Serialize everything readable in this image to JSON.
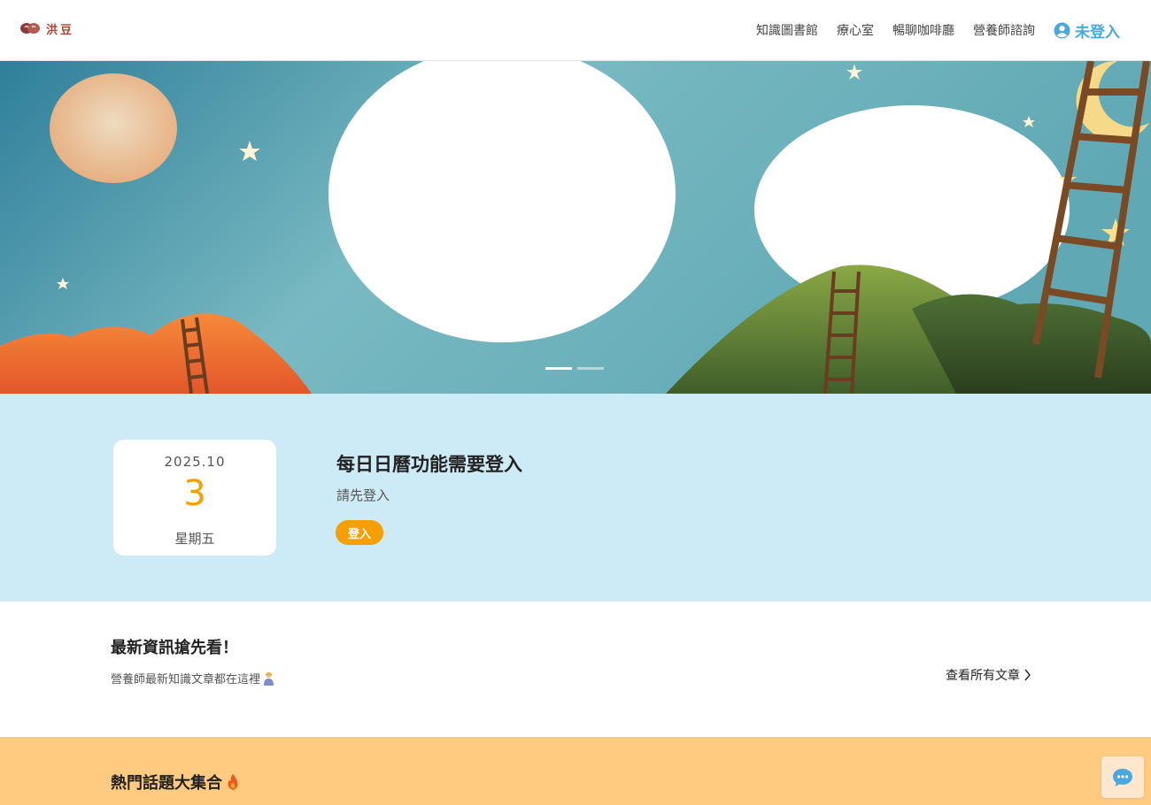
{
  "header": {
    "brand": "洪豆",
    "nav": [
      {
        "label": "知識圖書館"
      },
      {
        "label": "療心室"
      },
      {
        "label": "暢聊咖啡廳"
      },
      {
        "label": "營養師諮詢"
      }
    ],
    "user_label": "未登入",
    "user_icon": "user-circle-icon"
  },
  "banner": {
    "slides_total": 2,
    "active_slide": 1
  },
  "calendar": {
    "year_month": "2025.10",
    "day": "3",
    "weekday": "星期五",
    "title": "每日日曆功能需要登入",
    "subtitle": "請先登入",
    "login_button": "登入"
  },
  "news": {
    "title": "最新資訊搶先看！",
    "subtitle": "營養師最新知識文章都在這裡",
    "all_link": "查看所有文章"
  },
  "hot": {
    "title": "熱門話題大集合"
  },
  "colors": {
    "accent_blue": "#49a8dc",
    "accent_orange": "#f59f00",
    "calendar_bg": "#cdebf7",
    "hot_bg": "#ffcb80"
  }
}
